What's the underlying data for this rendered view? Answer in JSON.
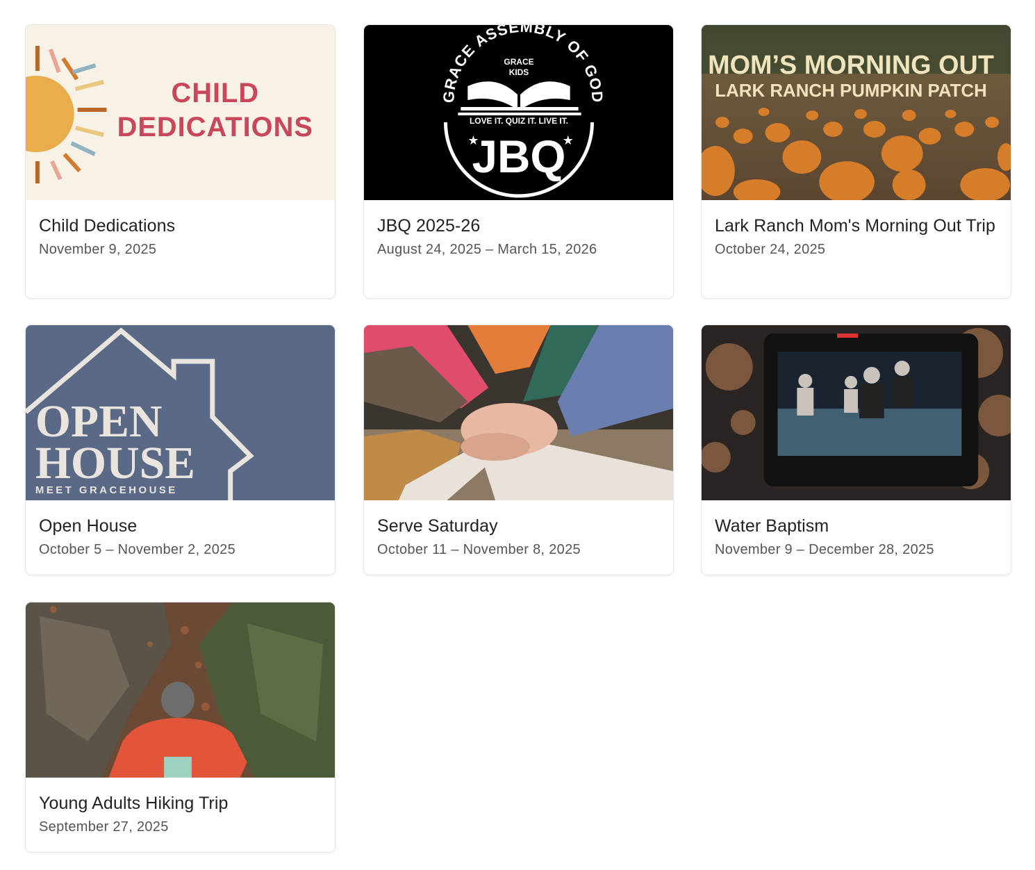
{
  "events": [
    {
      "title": "Child Dedications",
      "date": "November 9, 2025",
      "image": {
        "kind": "graphic",
        "text": [
          "CHILD",
          "DEDICATIONS"
        ],
        "bg": "#f7f1e6",
        "accent": "#c8475a"
      }
    },
    {
      "title": "JBQ 2025-26",
      "date": "August 24, 2025 – March 15, 2026",
      "image": {
        "kind": "logo",
        "text": [
          "GRACE ASSEMBLY OF GOD",
          "GRACE",
          "KIDS",
          "LOVE IT. QUIZ IT. LIVE IT.",
          "JBQ"
        ],
        "bg": "#000000"
      }
    },
    {
      "title": "Lark Ranch Mom's Morning Out Trip",
      "date": "October 24, 2025",
      "image": {
        "kind": "photo-with-text",
        "text": [
          "MOM’S MORNING OUT",
          "LARK RANCH PUMPKIN PATCH"
        ]
      }
    },
    {
      "title": "Open House",
      "date": "October 5 – November 2, 2025",
      "image": {
        "kind": "graphic",
        "text": [
          "OPEN",
          "HOUSE",
          "MEET GRACEHOUSE"
        ],
        "bg": "#5a6a86"
      }
    },
    {
      "title": "Serve Saturday",
      "date": "October 11 – November 8, 2025",
      "image": {
        "kind": "photo",
        "subject": "stacked hands"
      }
    },
    {
      "title": "Water Baptism",
      "date": "November 9 – December 28, 2025",
      "image": {
        "kind": "photo",
        "subject": "camera monitor with worship stage"
      }
    },
    {
      "title": "Young Adults Hiking Trip",
      "date": "September 27, 2025",
      "image": {
        "kind": "photo",
        "subject": "hiker between rocks"
      }
    }
  ]
}
